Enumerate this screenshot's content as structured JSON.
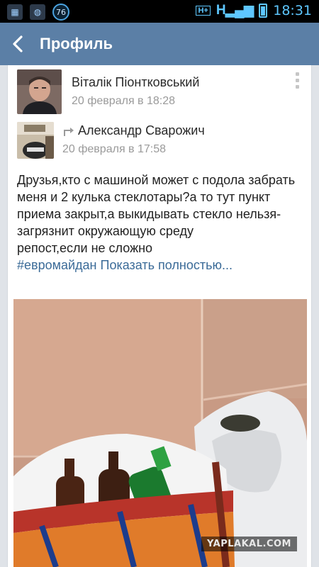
{
  "status_bar": {
    "notif_count": "76",
    "network": "H+",
    "time": "18:31"
  },
  "header": {
    "title": "Профиль"
  },
  "post": {
    "author_name": "Віталік Піонтковський",
    "date": "20 февраля в 18:28",
    "repost": {
      "author_name": "Александр Сварожич",
      "date": "20 февраля в 17:58"
    },
    "text": "Друзья,кто с машиной может с подола забрать меня и 2 кулька стеклотары?а то тут пункт приема закрыт,а выкидывать стекло нельзя- загрязнит окружающую среду\nрепост,если не сложно",
    "hashtag": "#евромайдан",
    "show_more": "Показать полностью..."
  },
  "watermark": "YAPLAKAL.COM",
  "colors": {
    "header_bg": "#5b7fa6",
    "link": "#3b6b98",
    "status_accent": "#5ec7ff"
  }
}
